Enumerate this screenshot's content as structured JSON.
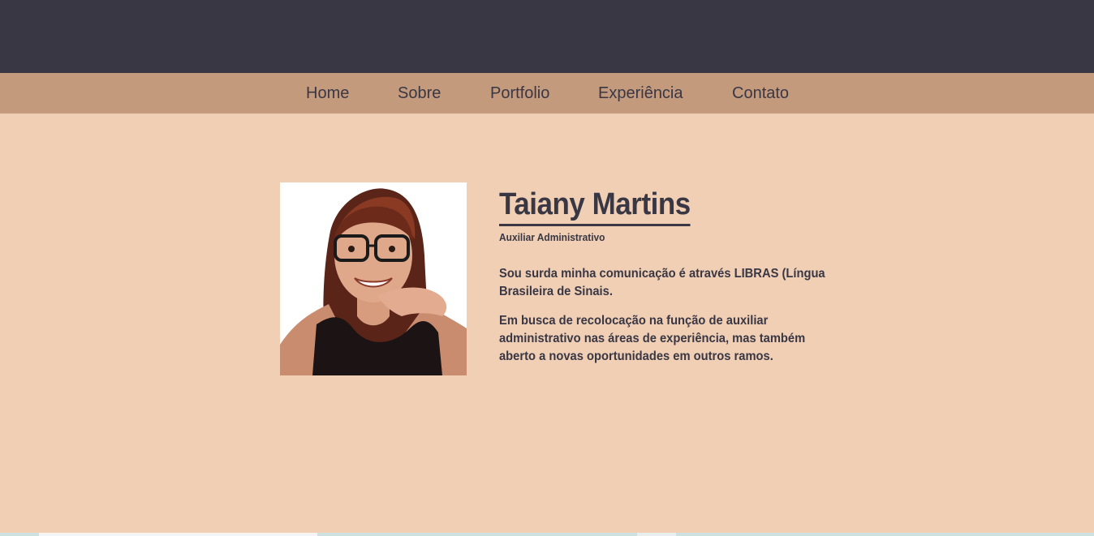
{
  "nav": {
    "items": [
      {
        "label": "Home"
      },
      {
        "label": "Sobre"
      },
      {
        "label": "Portfolio"
      },
      {
        "label": "Experiência"
      },
      {
        "label": "Contato"
      }
    ]
  },
  "profile": {
    "name": "Taiany Martins",
    "role": "Auxiliar Administrativo",
    "paragraph1": "Sou surda minha comunicação é através LIBRAS (Língua Brasileira de Sinais.",
    "paragraph2": "Em busca de recolocação na função de auxiliar administrativo nas áreas de experiência, mas também aberto a novas oportunidades em outros ramos."
  },
  "colors": {
    "header_bg": "#3a3745",
    "nav_bg": "#c49a7c",
    "page_bg": "#f0cfb4",
    "text": "#3a3745"
  }
}
